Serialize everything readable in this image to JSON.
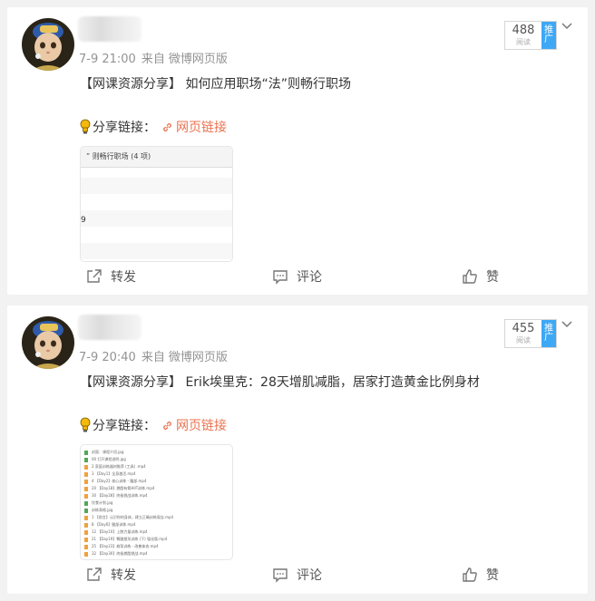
{
  "posts": [
    {
      "username": "",
      "time": "7-9 21:00",
      "from_label": "来自",
      "source": "微博网页版",
      "read_count": "488",
      "read_label": "阅读",
      "promote_label": "推广",
      "title": "【网课资源分享】 如何应用职场“法”则畅行职场",
      "share_label": "分享链接：",
      "link_text": "网页链接",
      "thumbnail": {
        "header": "” 则畅行职场 (4 项)",
        "side_char": "9"
      },
      "actions": {
        "forward": "转发",
        "comment": "评论",
        "like": "赞"
      }
    },
    {
      "username": "",
      "time": "7-9 20:40",
      "from_label": "来自",
      "source": "微博网页版",
      "read_count": "455",
      "read_label": "阅读",
      "promote_label": "推广",
      "title": "【网课资源分享】 Erik埃里克：28天增肌减脂，居家打造黄金比例身材",
      "share_label": "分享链接：",
      "link_text": "网页链接",
      "thumbnail": {
        "files": [
          {
            "type": "img",
            "name": "封面：课程介绍.jpg"
          },
          {
            "type": "img",
            "name": "00 打开课程说明.jpg"
          },
          {
            "type": "vid",
            "name": "2 家庭训练器材推荐 (工具) .mp4"
          },
          {
            "type": "vid",
            "name": "3 【Day1】全身激活.mp4"
          },
          {
            "type": "vid",
            "name": "4 【Day2】核心训练 - 腹部.mp4"
          },
          {
            "type": "vid",
            "name": "20 【Day18】燃脂有氧HIIT训练.mp4"
          },
          {
            "type": "vid",
            "name": "30 【Day28】终极挑战训练.mp4"
          },
          {
            "type": "img",
            "name": "饮食计划.jpg"
          },
          {
            "type": "img",
            "name": "训练表格.jpg"
          },
          {
            "type": "vid",
            "name": "1 【前言】认识你的身体，建立正确训练观念.mp4"
          },
          {
            "type": "vid",
            "name": "8 【Day6】腿部训练.mp4"
          },
          {
            "type": "vid",
            "name": "12 【Day10】上肢力量训练.mp4"
          },
          {
            "type": "vid",
            "name": "21 【Day19】臀腿塑形训练 (下) 强化版.mp4"
          },
          {
            "type": "vid",
            "name": "25 【Day23】肩背训练 - 改善体态.mp4"
          },
          {
            "type": "vid",
            "name": "32 【Day30】终极燃脂挑战.mp4"
          }
        ]
      },
      "actions": {
        "forward": "转发",
        "comment": "评论",
        "like": "赞"
      }
    }
  ],
  "colors": {
    "page_bg": "#f2f2f2",
    "card_bg": "#ffffff",
    "link": "#eb7350",
    "promote_bg": "#3ea8f5",
    "meta_text": "#939393"
  },
  "icons": [
    "avatar-icon",
    "chevron-down-icon",
    "lightbulb-icon",
    "link-icon",
    "forward-icon",
    "comment-icon",
    "like-icon"
  ]
}
